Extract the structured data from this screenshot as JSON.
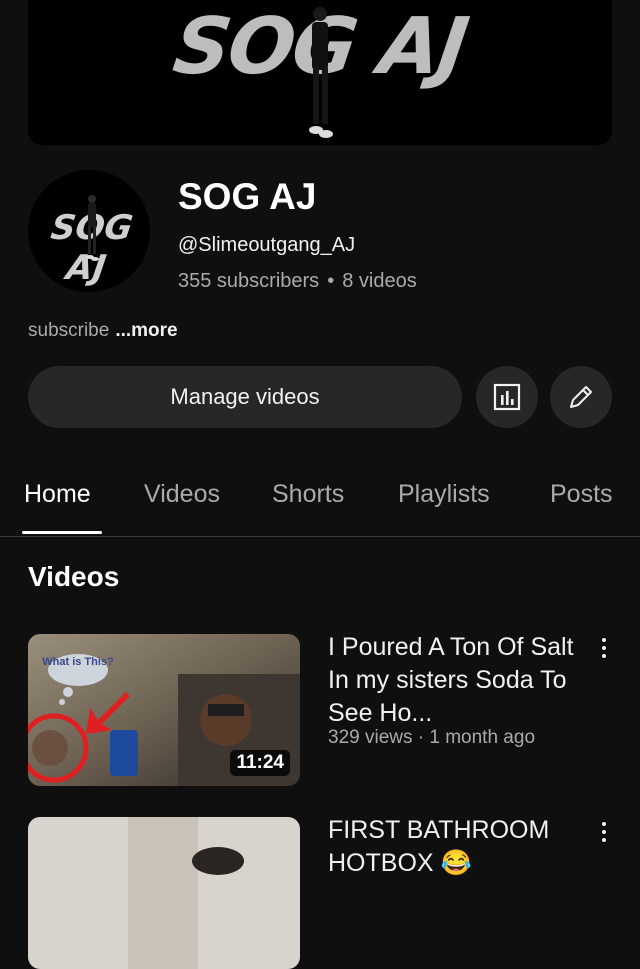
{
  "banner": {
    "text": "SOG AJ"
  },
  "avatar": {
    "text": "SOG AJ"
  },
  "channel": {
    "name": "SOG AJ",
    "handle": "@Slimeoutgang_AJ",
    "subscribers": "355 subscribers",
    "separator": "•",
    "videos": "8 videos"
  },
  "description": {
    "text": "subscribe",
    "more": "...more"
  },
  "actions": {
    "manage_label": "Manage videos",
    "analytics_icon": "analytics-icon",
    "edit_icon": "pencil-icon"
  },
  "tabs": [
    {
      "label": "Home",
      "active": true
    },
    {
      "label": "Videos"
    },
    {
      "label": "Shorts"
    },
    {
      "label": "Playlists"
    },
    {
      "label": "Posts"
    }
  ],
  "section": {
    "title": "Videos"
  },
  "videos": [
    {
      "title": "I Poured A Ton Of Salt In my sisters Soda To See Ho...",
      "meta": "329 views · 1 month ago",
      "duration": "11:24",
      "thumb_caption": "What is This?"
    },
    {
      "title": "FIRST BATHROOM HOTBOX 😂"
    }
  ],
  "colors": {
    "background": "#0f0f0f",
    "button": "#272727",
    "secondary_text": "#aaaaaa"
  }
}
